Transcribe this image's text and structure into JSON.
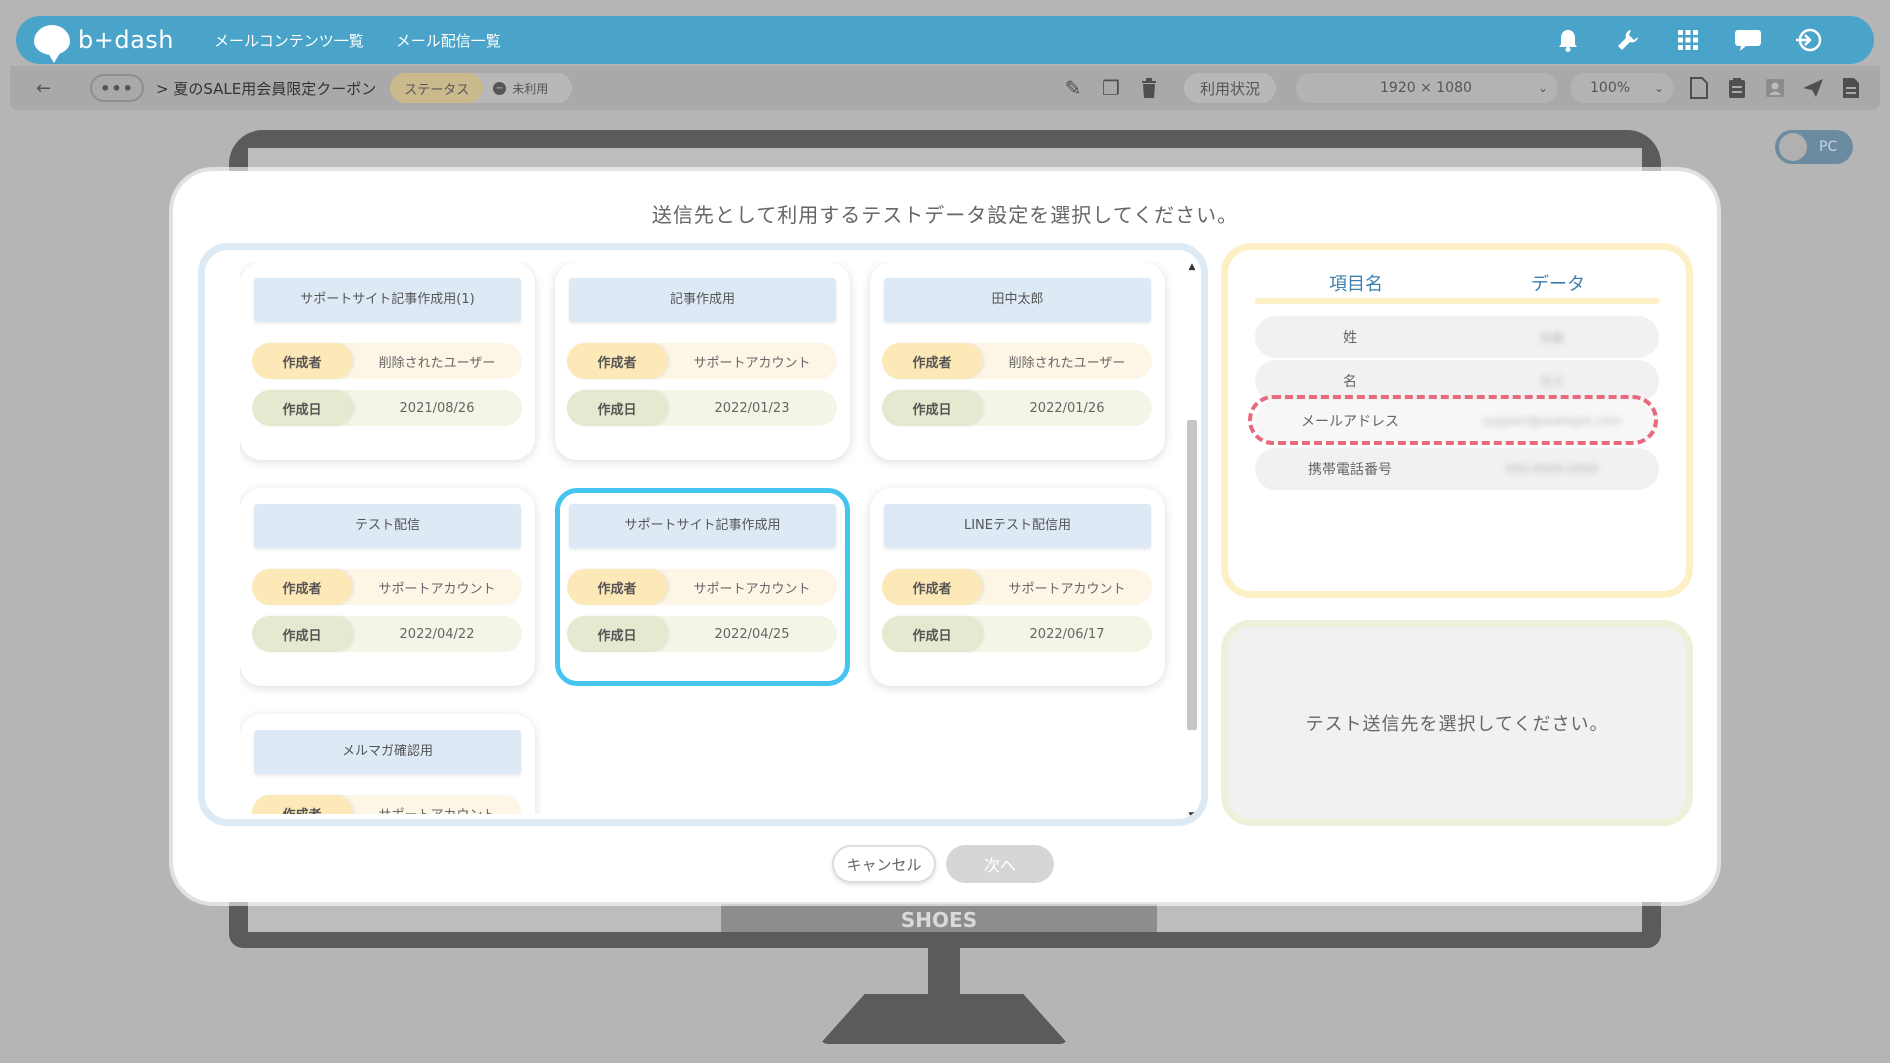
{
  "header": {
    "logo_text": "b+dash",
    "nav": [
      "メールコンテンツ一覧",
      "メール配信一覧"
    ],
    "icons": [
      "bell-icon",
      "wrench-icon",
      "grid-icon",
      "chat-icon",
      "logout-icon"
    ]
  },
  "toolbar": {
    "back_icon": "←",
    "more_label": "•••",
    "breadcrumb": "> 夏のSALE用会員限定クーポン",
    "status_label": "ステータス",
    "status_value": "未利用",
    "usage_label": "利用状況",
    "resolution": "1920 × 1080",
    "zoom": "100%"
  },
  "preview": {
    "device_label": "PC",
    "banner_text": "SHOES"
  },
  "modal": {
    "title": "送信先として利用するテストデータ設定を選択してください。",
    "author_label": "作成者",
    "date_label": "作成日",
    "cards": [
      {
        "title": "サポートサイト記事作成用(1)",
        "author": "削除されたユーザー",
        "date": "2021/08/26"
      },
      {
        "title": "記事作成用",
        "author": "サポートアカウント",
        "date": "2022/01/23"
      },
      {
        "title": "田中太郎",
        "author": "削除されたユーザー",
        "date": "2022/01/26"
      },
      {
        "title": "テスト配信",
        "author": "サポートアカウント",
        "date": "2022/04/22"
      },
      {
        "title": "サポートサイト記事作成用",
        "author": "サポートアカウント",
        "date": "2022/04/25",
        "selected": true
      },
      {
        "title": "LINEテスト配信用",
        "author": "サポートアカウント",
        "date": "2022/06/17"
      },
      {
        "title": "メルマガ確認用",
        "author": "サポートアカウント",
        "date": ""
      }
    ],
    "data_table": {
      "col_name": "項目名",
      "col_data": "データ",
      "rows": [
        {
          "name": "姓",
          "value": "佐藤"
        },
        {
          "name": "名",
          "value": "花子"
        },
        {
          "name": "メールアドレス",
          "value": "support@example.com"
        },
        {
          "name": "携帯電話番号",
          "value": "090-0000-0000"
        }
      ]
    },
    "message": "テスト送信先を選択してください。",
    "cancel_label": "キャンセル",
    "next_label": "次へ"
  }
}
